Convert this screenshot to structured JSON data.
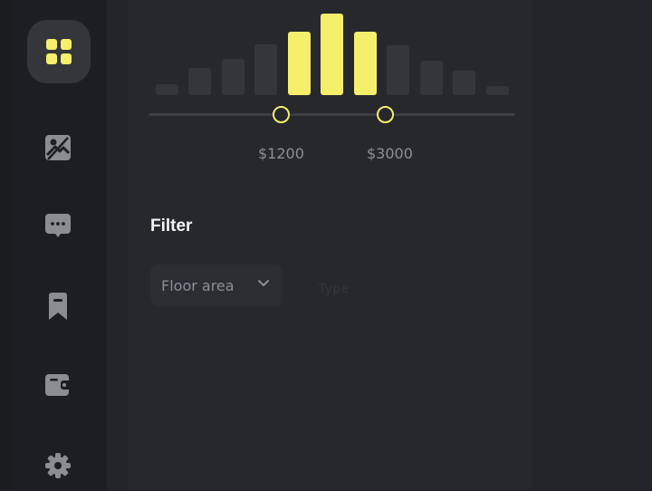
{
  "sidebar": {
    "items": [
      {
        "icon": "grid-icon",
        "active": true
      },
      {
        "icon": "image-icon",
        "active": false
      },
      {
        "icon": "chat-icon",
        "active": false
      },
      {
        "icon": "bookmark-icon",
        "active": false
      },
      {
        "icon": "wallet-icon",
        "active": false
      },
      {
        "icon": "settings-icon",
        "active": false
      }
    ]
  },
  "price_range": {
    "min_label": "$1200",
    "max_label": "$3000",
    "histogram": [
      0.12,
      0.3,
      0.4,
      0.56,
      0.7,
      0.9,
      0.7,
      0.55,
      0.38,
      0.27,
      0.1
    ],
    "selected_bars": [
      4,
      5,
      6
    ]
  },
  "filter": {
    "title": "Filter",
    "dropdown_label": "Floor area",
    "secondary_label": "Type"
  },
  "colors": {
    "accent": "#f6ef6c",
    "background": "#1f2124",
    "panel": "#26282c",
    "inactive_icon": "#8a8d92"
  }
}
